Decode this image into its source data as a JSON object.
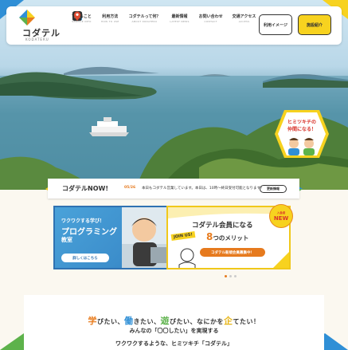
{
  "header": {
    "logo_text": "コダテル",
    "logo_sub": "KODATERU",
    "nav": [
      {
        "label": "できること",
        "sub": "SERVICE INFO",
        "icon": "people-icon"
      },
      {
        "label": "利用方法",
        "sub": "HOW TO USE",
        "icon": "document-icon"
      },
      {
        "label": "コダテルって何？",
        "sub": "ABOUT KODATERU",
        "icon": "bus-icon"
      },
      {
        "label": "最新情報",
        "sub": "LATEST NEWS",
        "icon": "news-icon"
      },
      {
        "label": "お問い合わせ",
        "sub": "CONTACT",
        "icon": "chat-icon"
      },
      {
        "label": "交通アクセス",
        "sub": "ACCESS",
        "icon": "map-pin-icon"
      }
    ],
    "btn_usage": "利用イメージ",
    "btn_facility": "施設紹介"
  },
  "badge": {
    "line1": "ヒミツキチの",
    "line2": "仲間になる！"
  },
  "now": {
    "title": "コダテルNOW!",
    "date": "05/26",
    "text": "本日もコダテル営業しています。本日は、10時〜終日受付可能となります！",
    "more": "更新情報"
  },
  "banner_left": {
    "small": "ワクワクする学び！",
    "title1": "プログラミング",
    "title2": "教室",
    "btn": "詳しくはこちら"
  },
  "banner_right": {
    "title": "コダテル会員になる",
    "merit_num": "8",
    "merit_text": "つのメリット",
    "joinus": "JOIN US!",
    "btn": "コダテル新規会員募集中！",
    "new_a": "入会者",
    "new_b": "NEW"
  },
  "catch": {
    "line1_parts": [
      "学",
      "びたい、",
      "働",
      "きたい、",
      "遊",
      "びたい、なにかを",
      "企",
      "てたい！"
    ],
    "line2": "みんなの「〇〇したい」を実現する",
    "line3": "ワクワクするような、ヒミツキチ「コダテル」"
  },
  "colors": {
    "accent_orange": "#e67a1e",
    "accent_yellow": "#f7d21f",
    "accent_blue": "#2f72b2"
  }
}
